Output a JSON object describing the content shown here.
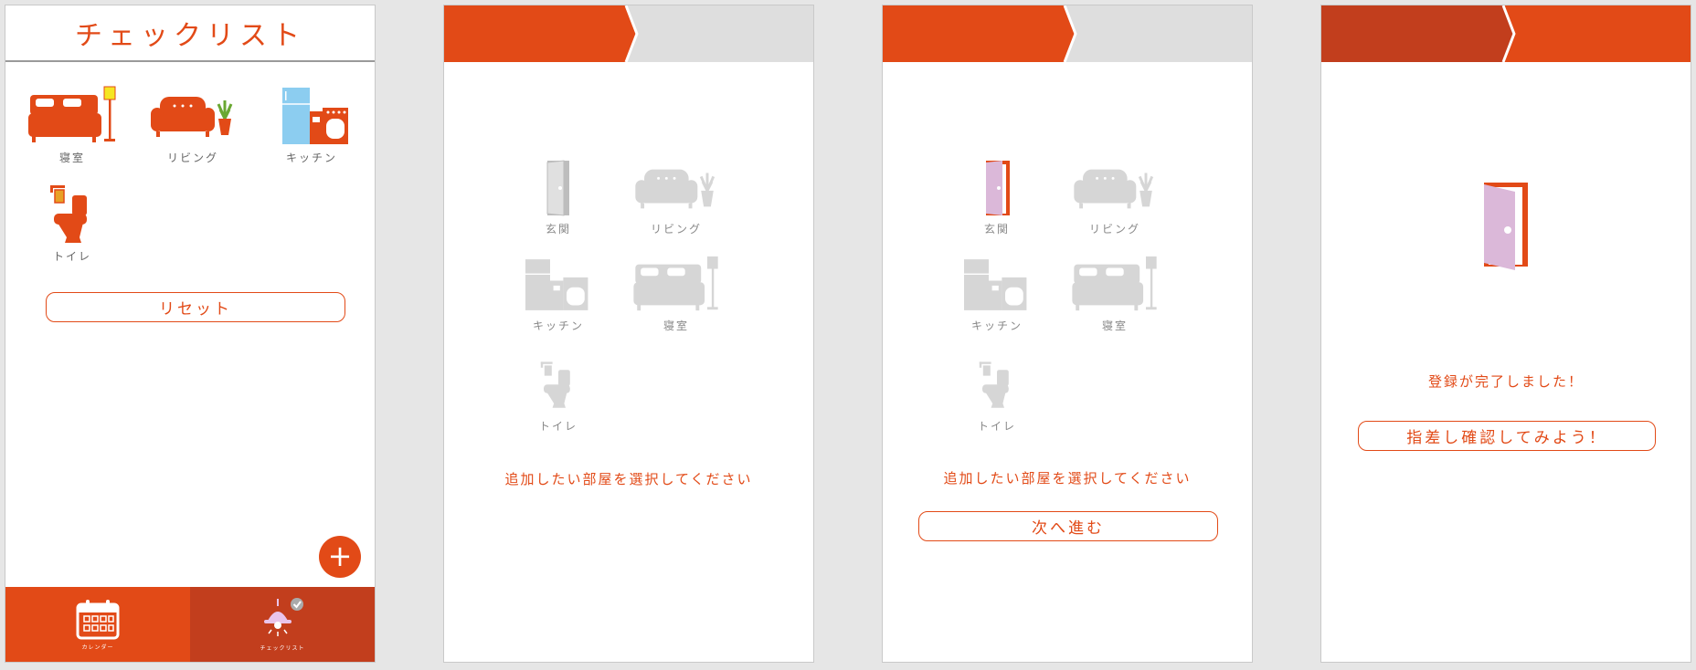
{
  "screen1": {
    "title": "チェックリスト",
    "rooms": [
      {
        "label": "寝室",
        "icon": "bed-icon"
      },
      {
        "label": "リビング",
        "icon": "sofa-icon"
      },
      {
        "label": "キッチン",
        "icon": "kitchen-icon"
      },
      {
        "label": "トイレ",
        "icon": "toilet-icon"
      }
    ],
    "reset_label": "リセット",
    "fab_label": "+",
    "tabs": [
      {
        "label": "カレンダー",
        "icon": "calendar-icon"
      },
      {
        "label": "チェックリスト",
        "icon": "lamp-check-icon"
      }
    ]
  },
  "screen2": {
    "rooms": [
      {
        "label": "玄関",
        "icon": "door-icon"
      },
      {
        "label": "リビング",
        "icon": "sofa-icon"
      },
      {
        "label": "キッチン",
        "icon": "kitchen-icon"
      },
      {
        "label": "寝室",
        "icon": "bed-icon"
      },
      {
        "label": "トイレ",
        "icon": "toilet-icon"
      }
    ],
    "message": "追加したい部屋を選択してください"
  },
  "screen3": {
    "rooms": [
      {
        "label": "玄関",
        "icon": "door-icon"
      },
      {
        "label": "リビング",
        "icon": "sofa-icon"
      },
      {
        "label": "キッチン",
        "icon": "kitchen-icon"
      },
      {
        "label": "寝室",
        "icon": "bed-icon"
      },
      {
        "label": "トイレ",
        "icon": "toilet-icon"
      }
    ],
    "message": "追加したい部屋を選択してください",
    "next_label": "次へ進む"
  },
  "screen4": {
    "message": "登録が完了しました！",
    "confirm_label": "指差し確認してみよう！"
  },
  "colors": {
    "accent": "#e24a17",
    "accent_dark": "#c23e1d",
    "gray": "#d7d7d7",
    "door_pink": "#dbb8d9",
    "fridge_blue": "#8ccdf0",
    "lamp_yellow": "#f5e623"
  }
}
